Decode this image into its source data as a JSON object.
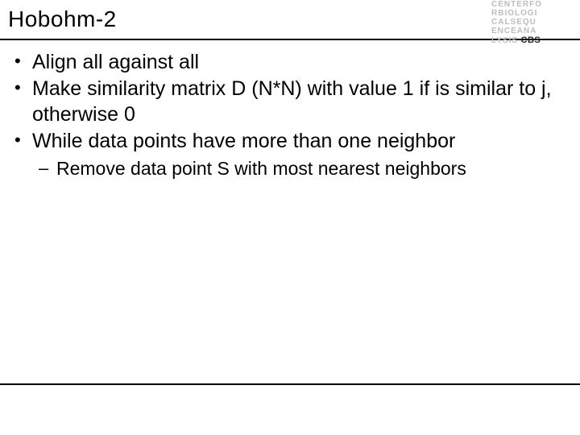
{
  "title": "Hobohm-2",
  "logo": {
    "line1": "CENTERFO",
    "line2": "RBIOLOGI",
    "line3": "CALSEQU",
    "line4": "ENCEANA",
    "line5": "LYSIS",
    "brand": "CBS"
  },
  "bullets": [
    "Align all against all",
    "Make similarity matrix D (N*N) with value 1 if is similar to j, otherwise 0",
    "While data points have more than one neighbor"
  ],
  "subbullets": [
    "Remove data point S with most nearest neighbors"
  ]
}
